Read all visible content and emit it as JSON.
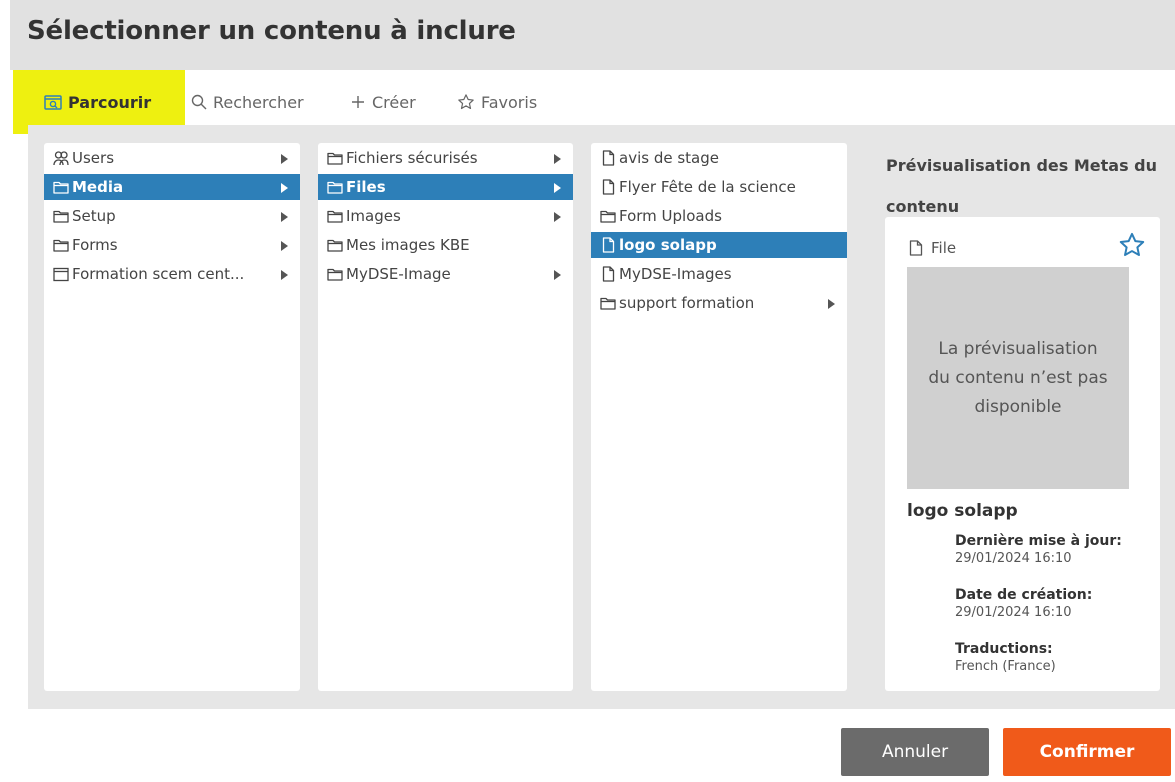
{
  "dialog": {
    "title": "Sélectionner un contenu à inclure"
  },
  "tabs": [
    {
      "label": "Parcourir",
      "icon": "browse-icon",
      "active": true
    },
    {
      "label": "Rechercher",
      "icon": "search-icon",
      "active": false
    },
    {
      "label": "Créer",
      "icon": "plus-icon",
      "active": false
    },
    {
      "label": "Favoris",
      "icon": "star-icon",
      "active": false
    }
  ],
  "columns": {
    "col1": [
      {
        "label": "Users",
        "icon": "users-icon",
        "has_children": true,
        "selected": false
      },
      {
        "label": "Media",
        "icon": "folder-icon",
        "has_children": true,
        "selected": true
      },
      {
        "label": "Setup",
        "icon": "folder-icon",
        "has_children": true,
        "selected": false
      },
      {
        "label": "Forms",
        "icon": "folder-icon",
        "has_children": true,
        "selected": false
      },
      {
        "label": "Formation scem cent...",
        "icon": "window-icon",
        "has_children": true,
        "selected": false
      }
    ],
    "col2": [
      {
        "label": "Fichiers sécurisés",
        "icon": "folder-icon",
        "has_children": true,
        "selected": false
      },
      {
        "label": "Files",
        "icon": "folder-icon",
        "has_children": true,
        "selected": true
      },
      {
        "label": "Images",
        "icon": "folder-icon",
        "has_children": true,
        "selected": false
      },
      {
        "label": "Mes images KBE",
        "icon": "folder-icon",
        "has_children": false,
        "selected": false
      },
      {
        "label": "MyDSE-Image",
        "icon": "folder-icon",
        "has_children": true,
        "selected": false
      }
    ],
    "col3": [
      {
        "label": "avis de stage",
        "icon": "file-icon",
        "has_children": false,
        "selected": false
      },
      {
        "label": "Flyer Fête de la science",
        "icon": "file-icon",
        "has_children": false,
        "selected": false
      },
      {
        "label": "Form Uploads",
        "icon": "folder-icon",
        "has_children": false,
        "selected": false
      },
      {
        "label": "logo solapp",
        "icon": "file-icon",
        "has_children": false,
        "selected": true
      },
      {
        "label": "MyDSE-Images",
        "icon": "file-icon",
        "has_children": false,
        "selected": false
      },
      {
        "label": "support formation",
        "icon": "folder-icon",
        "has_children": true,
        "selected": false
      }
    ]
  },
  "preview": {
    "heading": "Prévisualisation des Metas du contenu",
    "type_label": "File",
    "unavailable_text": "La prévisualisation du contenu n’est pas disponible",
    "name": "logo solapp",
    "last_update_label": "Dernière mise à jour:",
    "last_update_value": "29/01/2024 16:10",
    "created_label": "Date de création:",
    "created_value": "29/01/2024 16:10",
    "translations_label": "Traductions:",
    "translations_value": "French (France)"
  },
  "actions": {
    "cancel": "Annuler",
    "confirm": "Confirmer"
  },
  "colors": {
    "accent": "#2d7fb8",
    "highlight": "#eef010",
    "confirm": "#f05a1a",
    "cancel": "#6b6b6b"
  }
}
